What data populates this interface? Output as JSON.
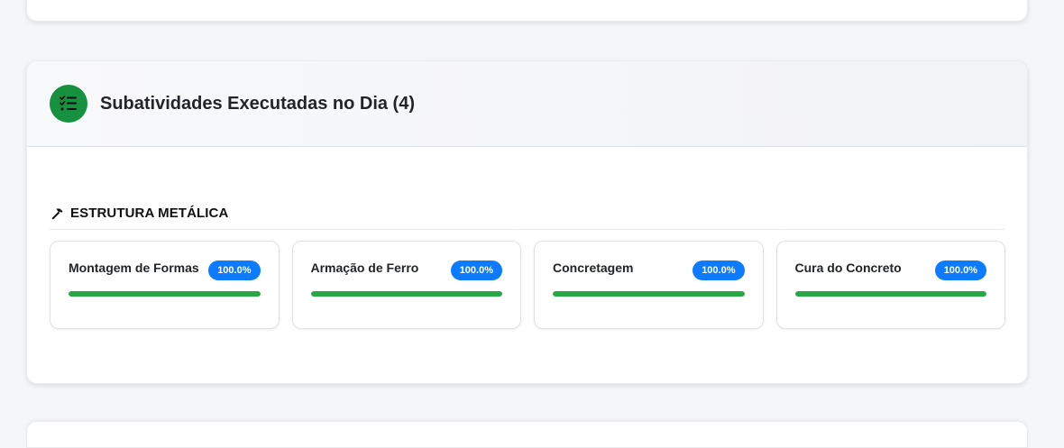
{
  "section": {
    "title": "Subatividades Executadas no Dia (4)",
    "icon": "task-list-icon",
    "icon_color": "#17903f"
  },
  "group": {
    "icon": "hammer-icon",
    "title": "ESTRUTURA METÁLICA"
  },
  "subactivities": [
    {
      "name": "Montagem de Formas",
      "badge": "100.0%",
      "progress": 100
    },
    {
      "name": "Armação de Ferro",
      "badge": "100.0%",
      "progress": 100
    },
    {
      "name": "Concretagem",
      "badge": "100.0%",
      "progress": 100
    },
    {
      "name": "Cura do Concreto",
      "badge": "100.0%",
      "progress": 100
    }
  ],
  "colors": {
    "badge": "#0d7bff",
    "progress": "#28a745",
    "background": "#f5f6f8"
  }
}
